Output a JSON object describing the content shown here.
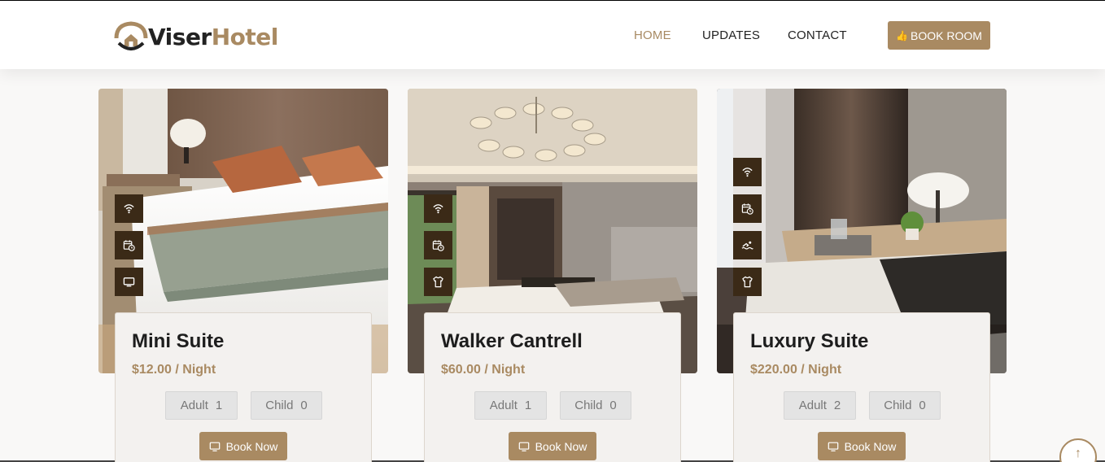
{
  "brand": {
    "name_a": "Viser",
    "name_b": "Hotel"
  },
  "nav": {
    "home": "HOME",
    "updates": "UPDATES",
    "contact": "CONTACT",
    "book_room": "BOOK ROOM"
  },
  "rooms": [
    {
      "name": "Mini Suite",
      "price": "$12.00 / Night",
      "adult_label": "Adult",
      "adult": "1",
      "child_label": "Child",
      "child": "0",
      "book": "Book Now",
      "features": [
        "wifi-icon",
        "calendar-clock-icon",
        "tv-icon"
      ]
    },
    {
      "name": "Walker Cantrell",
      "price": "$60.00 / Night",
      "adult_label": "Adult",
      "adult": "1",
      "child_label": "Child",
      "child": "0",
      "book": "Book Now",
      "features": [
        "wifi-icon",
        "calendar-clock-icon",
        "shirt-icon"
      ]
    },
    {
      "name": "Luxury Suite",
      "price": "$220.00 / Night",
      "adult_label": "Adult",
      "adult": "2",
      "child_label": "Child",
      "child": "0",
      "book": "Book Now",
      "features": [
        "wifi-icon",
        "calendar-clock-icon",
        "swimming-icon",
        "shirt-icon"
      ]
    }
  ],
  "colors": {
    "accent": "#a98a62",
    "feature_bg": "#3b2a17",
    "text": "#1d1d1d"
  }
}
